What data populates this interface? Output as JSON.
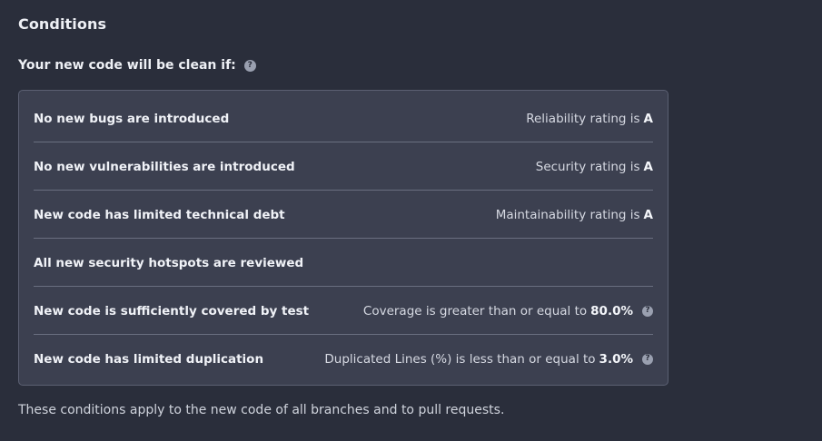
{
  "section_title": "Conditions",
  "subheading": "Your new code will be clean if:",
  "help_glyph": "?",
  "conditions": [
    {
      "label": "No new bugs are introduced",
      "value_text": "Reliability rating is",
      "value_strong": "A",
      "has_help": false
    },
    {
      "label": "No new vulnerabilities are introduced",
      "value_text": "Security rating is",
      "value_strong": "A",
      "has_help": false
    },
    {
      "label": "New code has limited technical debt",
      "value_text": "Maintainability rating is",
      "value_strong": "A",
      "has_help": false
    },
    {
      "label": "All new security hotspots are reviewed",
      "value_text": "",
      "value_strong": "",
      "has_help": false
    },
    {
      "label": "New code is sufficiently covered by test",
      "value_text": "Coverage is greater than or equal to",
      "value_strong": "80.0%",
      "has_help": true
    },
    {
      "label": "New code has limited duplication",
      "value_text": "Duplicated Lines (%) is less than or equal to",
      "value_strong": "3.0%",
      "has_help": true
    }
  ],
  "footer_note": "These conditions apply to the new code of all branches and to pull requests.",
  "colors": {
    "background": "#2a2e3b",
    "panel": "#3c4050",
    "panel_border": "#5b6072",
    "divider": "#6a6f80",
    "help_icon": "#9aa0b0"
  },
  "icons": {
    "help": "question-circle-icon"
  }
}
